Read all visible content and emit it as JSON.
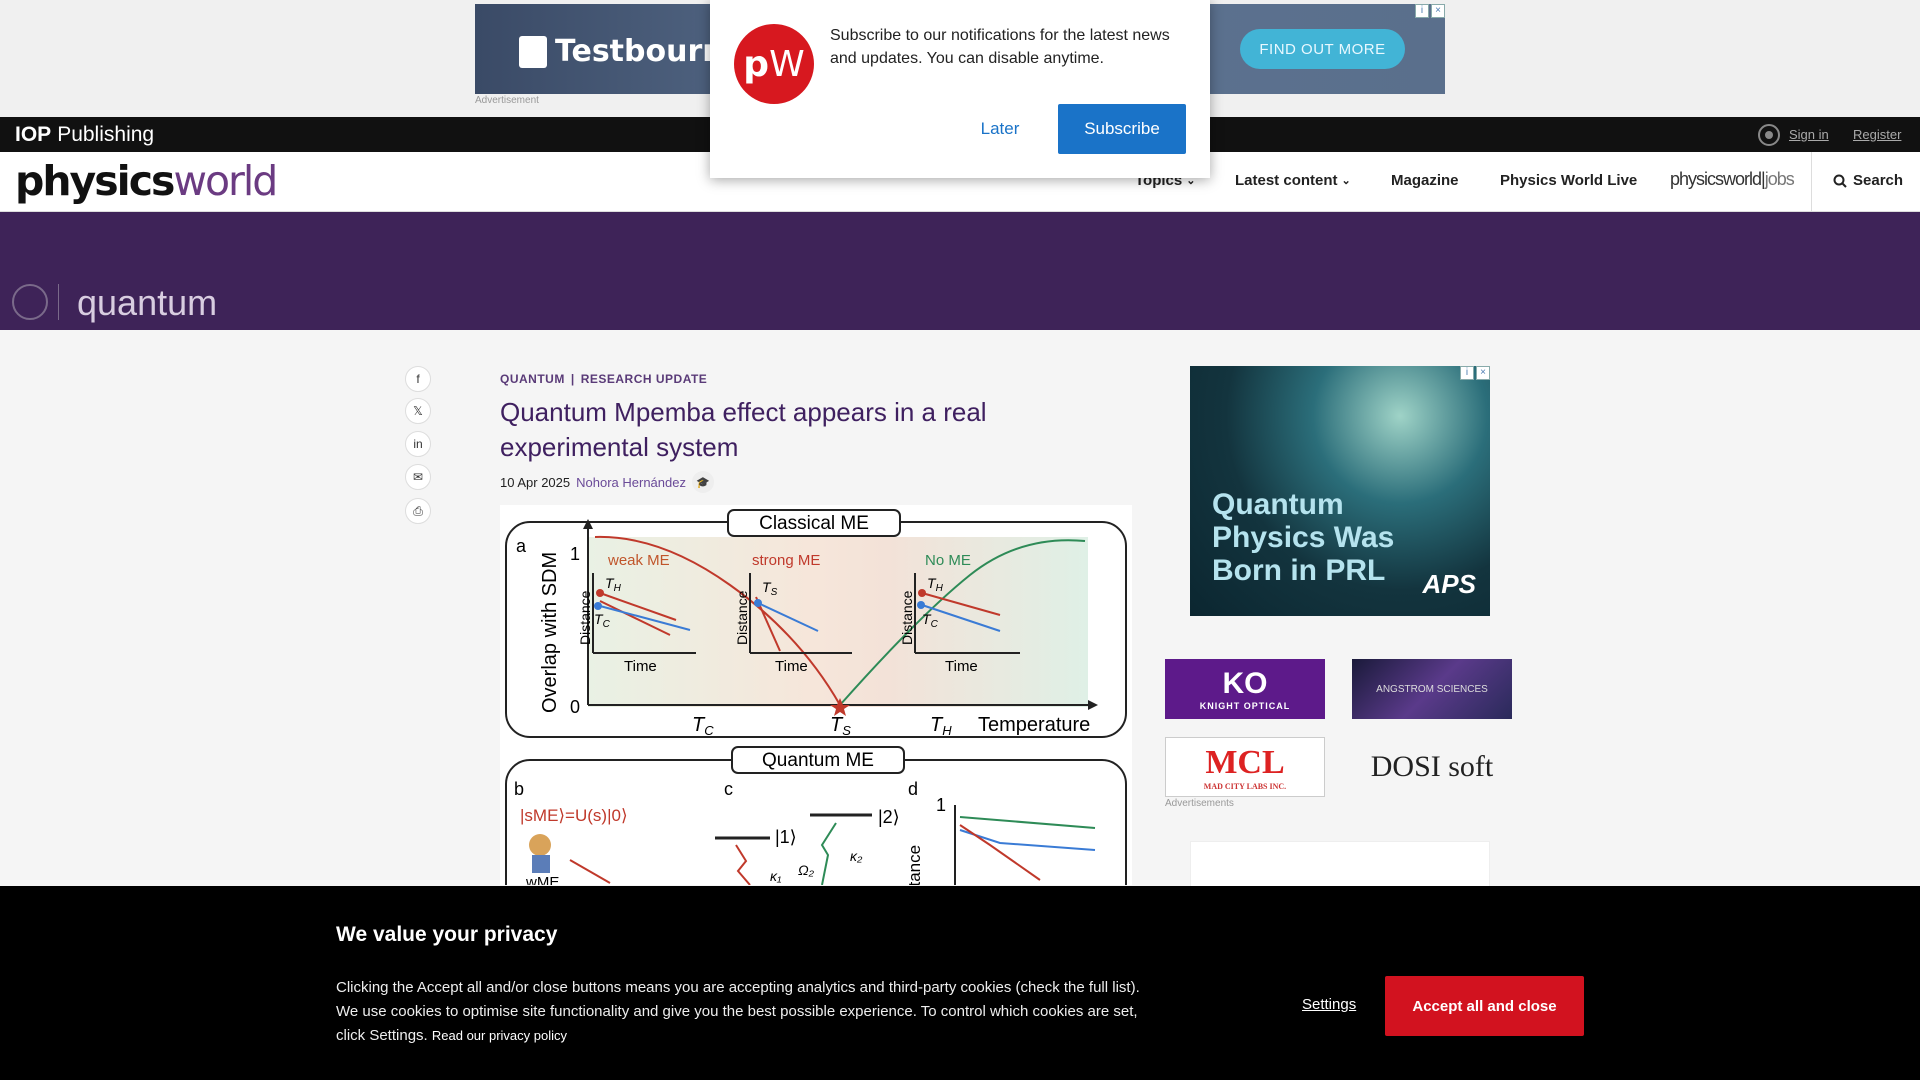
{
  "top_ad": {
    "brand": "Testbourne",
    "cta": "FIND OUT MORE",
    "label": "Advertisement"
  },
  "iop": {
    "brand_bold": "IOP",
    "brand_rest": "Publishing",
    "sign_in": "Sign in",
    "register": "Register"
  },
  "nav": {
    "logo_physics": "physics",
    "logo_world": "world",
    "items": [
      "Topics",
      "Latest content",
      "Magazine",
      "Physics World Live"
    ],
    "jobs_physics": "physicsworld",
    "jobs_label": "jobs",
    "search": "Search"
  },
  "banner": {
    "title": "quantum"
  },
  "article": {
    "category": "QUANTUM",
    "type": "RESEARCH UPDATE",
    "title": "Quantum Mpemba effect appears in a real experimental system",
    "date": "10 Apr 2025",
    "author": "Nohora Hernández"
  },
  "figure": {
    "top_title": "Classical ME",
    "bottom_title": "Quantum ME",
    "panel_a": "a",
    "y_axis": "Overlap with SDM",
    "y_one": "1",
    "y_zero": "0",
    "x_axis": "Temperature",
    "ticks": [
      "T",
      "T",
      "T"
    ],
    "tick_subs": [
      "C",
      "S",
      "H"
    ],
    "insets": [
      {
        "title": "weak ME",
        "ylabel": "Distance",
        "xlabel": "Time",
        "th": "T",
        "th_sub": "H",
        "tc": "T",
        "tc_sub": "C"
      },
      {
        "title": "strong ME",
        "ylabel": "Distance",
        "xlabel": "Time",
        "th": "T",
        "th_sub": "S",
        "tc": "",
        "tc_sub": ""
      },
      {
        "title": "No ME",
        "ylabel": "Distance",
        "xlabel": "Time",
        "th": "T",
        "th_sub": "H",
        "tc": "T",
        "tc_sub": "C"
      }
    ],
    "panel_b": "b",
    "panel_c": "c",
    "panel_d": "d",
    "smE": "|sME⟩=U(s)|0⟩",
    "wme": "wME",
    "ket1": "|1⟩",
    "ket2": "|2⟩",
    "omega2": "Ω₂",
    "kappa1": "κ₁",
    "kappa2": "κ₂",
    "d_one": "1",
    "d_ylabel": "stance"
  },
  "sidebar": {
    "ad1_text": "Quantum Physics Was Born in PRL",
    "ad1_brand": "APS",
    "ko_big": "KO",
    "ko_small": "KNIGHT OPTICAL",
    "ang": "ANGSTROM SCIENCES",
    "mcl_big": "MCL",
    "mcl_small": "MAD CITY LABS INC.",
    "dosi": "DOSI soft",
    "ads_label": "Advertisements"
  },
  "notification": {
    "badge_p": "p",
    "badge_w": "W",
    "message": "Subscribe to our notifications for the latest news and updates. You can disable anytime.",
    "later": "Later",
    "subscribe": "Subscribe"
  },
  "cookie": {
    "title": "We value your privacy",
    "body": "Clicking the Accept all and/or close buttons means you are accepting analytics and third-party cookies (check the full list). We use cookies to optimise site functionality and give you the best possible experience. To control which cookies are set, click Settings.",
    "policy": "Read our privacy policy",
    "settings": "Settings",
    "accept": "Accept all and close"
  },
  "colors": {
    "brand_purple": "#3e2358",
    "accent_red": "#d2121f",
    "link_blue": "#1a73c8"
  }
}
